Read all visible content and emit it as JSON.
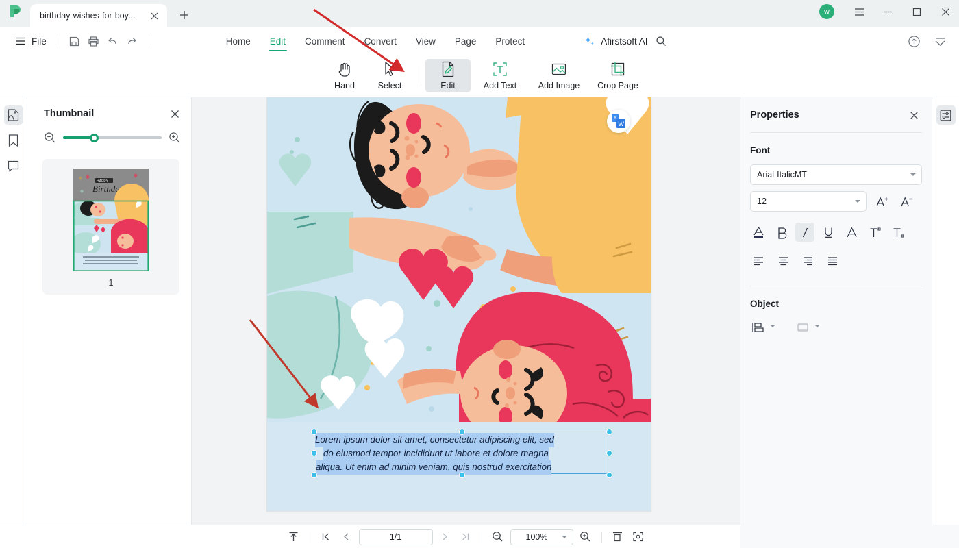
{
  "window": {
    "tab_title": "birthday-wishes-for-boy...",
    "avatar_initial": "w",
    "new_tab_label": "+",
    "minimize_label": "minimize",
    "maximize_label": "maximize",
    "close_label": "close"
  },
  "menubar": {
    "file_label": "File",
    "quick_icons": [
      "save-icon",
      "print-icon",
      "undo-icon",
      "redo-icon"
    ],
    "tabs": [
      {
        "label": "Home",
        "active": false
      },
      {
        "label": "Edit",
        "active": true
      },
      {
        "label": "Comment",
        "active": false
      },
      {
        "label": "Convert",
        "active": false
      },
      {
        "label": "View",
        "active": false
      },
      {
        "label": "Page",
        "active": false
      },
      {
        "label": "Protect",
        "active": false
      }
    ],
    "ai_label": "Afirstsoft AI",
    "search_icon": "search-icon",
    "cloud_icon": "cloud-upload-icon",
    "collapse_icon": "collapse-ribbon-icon"
  },
  "ribbon": {
    "buttons": [
      {
        "label": "Hand",
        "icon": "hand-icon",
        "active": false
      },
      {
        "label": "Select",
        "icon": "cursor-icon",
        "active": false
      },
      {
        "label": "Edit",
        "icon": "edit-page-icon",
        "active": true
      },
      {
        "label": "Add Text",
        "icon": "add-text-icon",
        "active": false
      },
      {
        "label": "Add Image",
        "icon": "add-image-icon",
        "active": false
      },
      {
        "label": "Crop Page",
        "icon": "crop-page-icon",
        "active": false
      }
    ]
  },
  "left_rail": {
    "items": [
      {
        "name": "thumbnail-panel-toggle",
        "icon": "thumbnail-icon",
        "active": true
      },
      {
        "name": "bookmark-panel-toggle",
        "icon": "bookmark-icon",
        "active": false
      },
      {
        "name": "comment-panel-toggle",
        "icon": "comment-icon",
        "active": false
      }
    ]
  },
  "thumbnail_panel": {
    "title": "Thumbnail",
    "close_label": "close",
    "zoom_out_icon": "zoom-out-icon",
    "zoom_in_icon": "zoom-in-icon",
    "slider_value": 27,
    "pages": [
      {
        "number": "1",
        "card_title": "HAPPY Birthday"
      }
    ]
  },
  "document": {
    "page_indicator": "1/1",
    "zoom_level": "100%",
    "translate_badge": "translate-to-word-icon",
    "card_heading": "HAPPY Birthday",
    "text_block": {
      "selected": true,
      "lines": [
        "Lorem ipsum dolor sit amet, consectetur adipiscing elit, sed",
        "do eiusmod tempor incididunt ut labore et dolore magna",
        "aliqua. Ut enim ad minim veniam, quis nostrud exercitation"
      ]
    },
    "annotations": [
      {
        "name": "annotation-arrow-top",
        "color": "#d32b2b"
      },
      {
        "name": "annotation-arrow-left",
        "color": "#c0392b"
      }
    ]
  },
  "properties": {
    "title": "Properties",
    "close_label": "close",
    "font_section": "Font",
    "font_family": "Arial-ItalicMT",
    "font_size": "12",
    "increase_size_icon": "increase-font-size-icon",
    "decrease_size_icon": "decrease-font-size-icon",
    "format_buttons": [
      {
        "name": "font-color-button",
        "icon": "font-color-icon",
        "label": "A",
        "active": false
      },
      {
        "name": "bold-button",
        "icon": "bold-icon",
        "label": "B",
        "active": false
      },
      {
        "name": "italic-button",
        "icon": "italic-icon",
        "label": "I",
        "active": true
      },
      {
        "name": "underline-button",
        "icon": "underline-icon",
        "label": "U",
        "active": false
      },
      {
        "name": "font-style-button",
        "icon": "font-style-icon",
        "label": "A",
        "active": false
      },
      {
        "name": "superscript-button",
        "icon": "superscript-icon",
        "label": "T",
        "active": false
      },
      {
        "name": "subscript-button",
        "icon": "subscript-icon",
        "label": "T",
        "active": false
      }
    ],
    "align_buttons": [
      {
        "name": "align-left-button",
        "icon": "align-left-icon"
      },
      {
        "name": "align-center-button",
        "icon": "align-center-icon"
      },
      {
        "name": "align-right-button",
        "icon": "align-right-icon"
      },
      {
        "name": "align-justify-button",
        "icon": "align-justify-icon"
      }
    ],
    "object_section": "Object",
    "object_buttons": [
      {
        "name": "object-align-button",
        "icon": "object-align-icon"
      },
      {
        "name": "object-arrange-button",
        "icon": "object-arrange-icon"
      }
    ]
  },
  "right_rail": {
    "items": [
      {
        "name": "properties-panel-toggle",
        "icon": "properties-sliders-icon",
        "active": true
      }
    ]
  },
  "statusbar": {
    "fit_top_icon": "scroll-to-top-icon",
    "first_page_icon": "first-page-icon",
    "prev_page_icon": "previous-page-icon",
    "page_indicator": "1/1",
    "next_page_icon": "next-page-icon",
    "last_page_icon": "last-page-icon",
    "zoom_out_icon": "zoom-out-icon",
    "zoom_level": "100%",
    "zoom_in_icon": "zoom-in-icon",
    "fit_width_icon": "fit-width-icon",
    "fullscreen_icon": "fullscreen-icon"
  },
  "colors": {
    "accent_green": "#17a673",
    "titlebar_bg": "#edf1f2",
    "annotation_red": "#d32b2b",
    "selection_blue": "#a9cdf2",
    "handle_cyan": "#3fc0e8"
  }
}
